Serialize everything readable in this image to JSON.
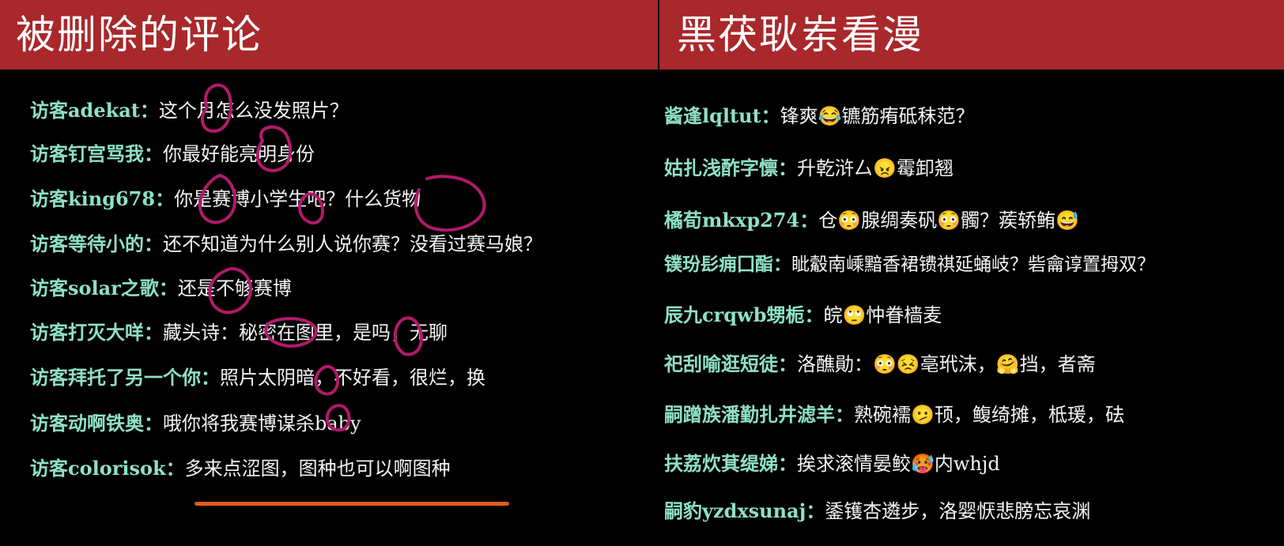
{
  "left": {
    "title": "被删除的评论",
    "colors": {
      "header_bg": "#a8282b",
      "name": "#8fe0c4",
      "text": "#f3f3f3",
      "ink_circles": "#b01a6a",
      "underline": "#e05a1c"
    },
    "comments": [
      {
        "name": "访客adekat",
        "sep": "：",
        "text": "这个月怎么没发照片？"
      },
      {
        "name": "访客钉宫骂我",
        "sep": "：",
        "text": "你最好能亮明身份"
      },
      {
        "name": "访客king678",
        "sep": "：",
        "text": "你是赛博小学生吧？什么货物"
      },
      {
        "name": "访客等待小的",
        "sep": "：",
        "text": "还不知道为什么别人说你赛？没看过赛马娘？"
      },
      {
        "name": "访客solar之歌",
        "sep": "：",
        "text": "还是不够赛博"
      },
      {
        "name": "访客打灭大咩",
        "sep": "：",
        "text": "藏头诗：秘密在图里，是吗，无聊"
      },
      {
        "name": "访客拜托了另一个你",
        "sep": "：",
        "text": "照片太阴暗，不好看，很烂，换"
      },
      {
        "name": "访客动啊铁奥",
        "sep": "：",
        "text": "哦你将我赛博谋杀baby"
      },
      {
        "name": "访客colorisok",
        "sep": "：",
        "text": "多来点涩图，图种也可以啊图种"
      }
    ]
  },
  "right": {
    "title": "黑茯耿岽看漫",
    "comments": [
      {
        "name": "酱逢lqltut",
        "sep": "：",
        "text": "锋爽😂镳筋痏砥秣范？"
      },
      {
        "name": "姑扎浅酢字懔",
        "sep": "：",
        "text": "升乾浒厶😠霉卸翘"
      },
      {
        "name": "橘荀mkxp274",
        "sep": "：",
        "text": "仓😳腺绸奏矾😳髑？蒺轿鲔😅"
      },
      {
        "name": "镤玢髟痈囗酯",
        "sep": "：",
        "text": "眦觳南嵊黯香裙镄祺延蛹岐？砦龠谆置拇双？"
      },
      {
        "name": "辰九crqwb甥栀",
        "sep": "：",
        "text": "皖🙄忡眷樯麦"
      },
      {
        "name": "祀刮喻逛短徒",
        "sep": "：",
        "text": "洛醮勛：😳😣亳玳沫，🤗挡，者斋"
      },
      {
        "name": "嗣蹭族潘勤扎井滤羊",
        "sep": "：",
        "text": "熟碗襦🫤顸，鳆绮摊，柢瑗，砝"
      },
      {
        "name": "扶荔炊萁缇娣",
        "sep": "：",
        "text": "挨求滚情晏鲛🥵内whjd"
      },
      {
        "name": "嗣豹yzdxsunaj",
        "sep": "：",
        "text": "鋈镬杏遴步，洛婴恹悲膀忘哀渊"
      }
    ]
  }
}
